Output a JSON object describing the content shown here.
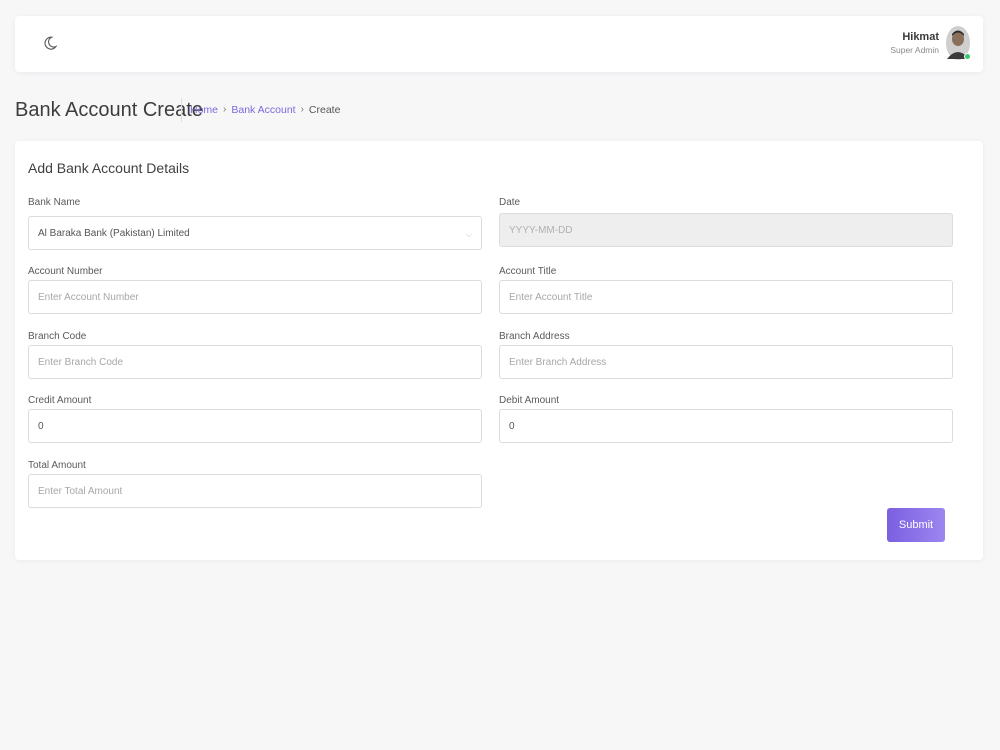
{
  "header": {
    "theme_toggle_icon": "moon-icon",
    "user": {
      "name": "Hikmat",
      "role": "Super Admin",
      "avatar_icon": "avatar-icon",
      "status_color": "#37c96b"
    }
  },
  "page": {
    "title": "Bank Account Create",
    "breadcrumb": [
      {
        "label": "Home"
      },
      {
        "label": "Bank Account"
      },
      {
        "label": "Create"
      }
    ]
  },
  "form": {
    "title": "Add Bank Account Details",
    "fields": {
      "bank_name": {
        "label": "Bank Name",
        "value": "Al Baraka Bank (Pakistan) Limited"
      },
      "date": {
        "label": "Date",
        "placeholder": "YYYY-MM-DD"
      },
      "account_number": {
        "label": "Account Number",
        "placeholder": "Enter Account Number"
      },
      "account_title": {
        "label": "Account Title",
        "placeholder": "Enter Account Title"
      },
      "branch_code": {
        "label": "Branch Code",
        "placeholder": "Enter Branch Code"
      },
      "branch_address": {
        "label": "Branch Address",
        "placeholder": "Enter Branch Address"
      },
      "credit_amount": {
        "label": "Credit Amount",
        "value": "0"
      },
      "debit_amount": {
        "label": "Debit Amount",
        "value": "0"
      },
      "total_amount": {
        "label": "Total Amount",
        "placeholder": "Enter Total Amount"
      }
    },
    "submit_label": "Submit",
    "accent_color": "#7b5fe0"
  }
}
